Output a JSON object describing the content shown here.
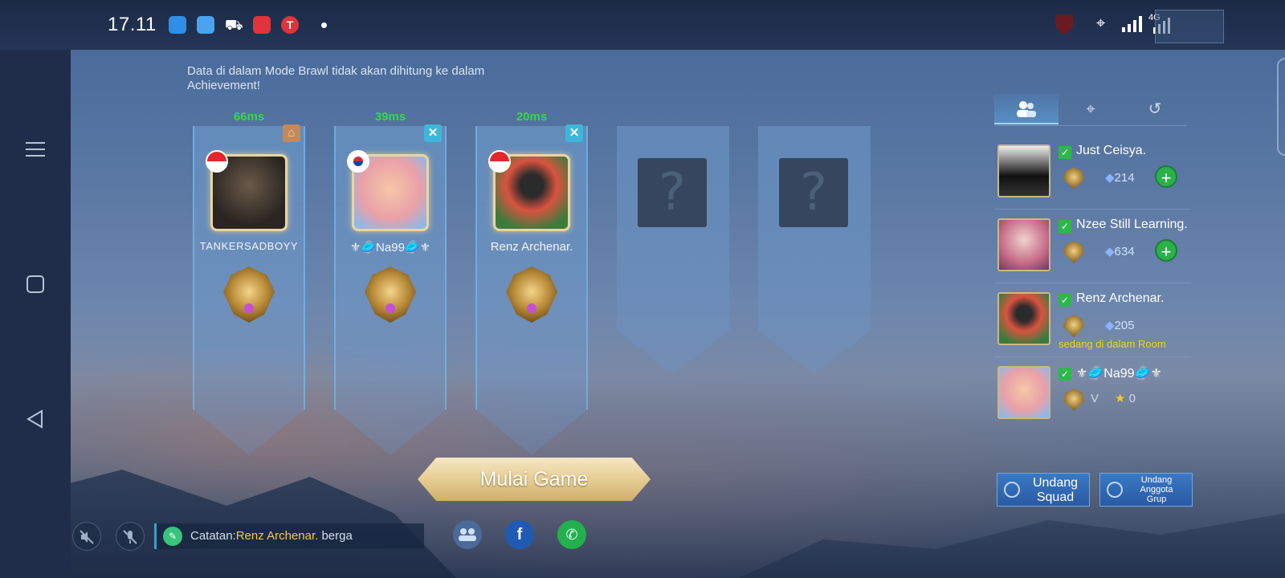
{
  "statusbar": {
    "time": "17.11",
    "network": "4G",
    "icons": [
      "app-icon-blue",
      "app-icon-chat",
      "car-icon",
      "video-record-icon",
      "app-icon-red-t",
      "shield-icon",
      "location-icon",
      "signal-icon",
      "network-signal-icon"
    ]
  },
  "nav": {
    "icons": [
      "menu-icon",
      "home-square-icon",
      "back-triangle-icon"
    ]
  },
  "lobby": {
    "notice": "Data di dalam Mode Brawl tidak akan dihitung ke dalam Achievement!",
    "slots": [
      {
        "ping": "66ms",
        "name": "TANKERSADBOYY",
        "flag": "Indonesia",
        "badge": "home"
      },
      {
        "ping": "39ms",
        "name": "⚜🥏Na99🥏⚜",
        "flag": "South Korea",
        "badge": "close"
      },
      {
        "ping": "20ms",
        "name": "Renz Archenar.",
        "flag": "Indonesia",
        "badge": "close"
      },
      {
        "placeholder": "?"
      },
      {
        "placeholder": "?"
      }
    ],
    "start_button": "Mulai Game"
  },
  "bottom": {
    "chat_prefix": "Catatan:",
    "chat_name": "Renz Archenar.",
    "chat_rest": " berga",
    "icons": [
      "speaker-mute-icon",
      "mic-mute-icon",
      "group-icon",
      "facebook-icon",
      "whatsapp-icon"
    ],
    "facebook_glyph": "f",
    "whatsapp_glyph": "✆"
  },
  "friends": {
    "tabs": [
      "friends-icon",
      "location-icon",
      "recent-icon"
    ],
    "list": [
      {
        "name": "Just Ceisya.",
        "diamonds": "214"
      },
      {
        "name": "Nzee Still Learning.",
        "diamonds": "634"
      },
      {
        "name": "Renz Archenar.",
        "diamonds": "205",
        "status": "sedang di dalam Room"
      },
      {
        "name": "⚜🥏Na99🥏⚜",
        "tier": "V",
        "stars": "0"
      }
    ],
    "invite_squad": "Undang Squad",
    "invite_group": "Undang Anggota Grup"
  },
  "colors": {
    "ping": "#35d84a",
    "status": "#f5d020",
    "add": "#2bb04a"
  }
}
